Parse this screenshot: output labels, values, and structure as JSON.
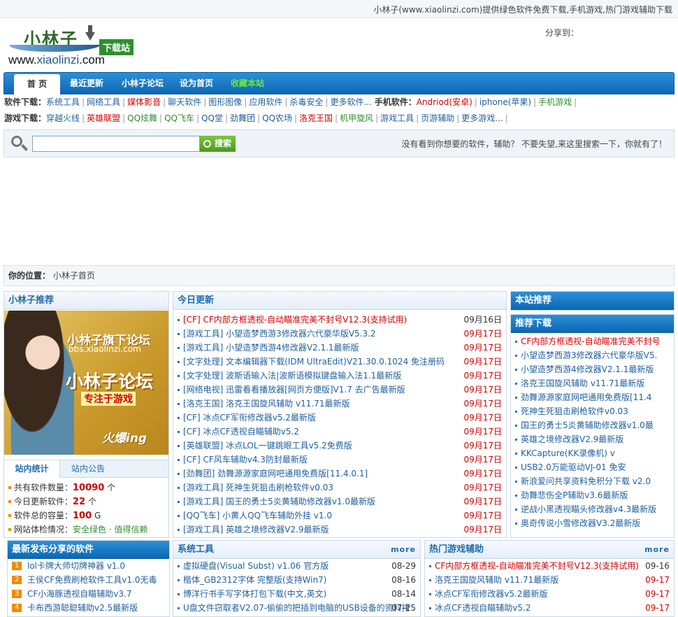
{
  "topbar": {
    "text": "小林子(www.xiaolinzi.com)提供绿色软件免费下载,手机游戏,热门游戏辅助下载"
  },
  "logo": {
    "cn": "小林子",
    "badge": "下载站",
    "url_prefix": "www.",
    "url_main": "xiaolinzi",
    "url_suffix": ".com"
  },
  "share": {
    "label": "分享到："
  },
  "nav": [
    {
      "label": "首 页",
      "active": true
    },
    {
      "label": "最近更新"
    },
    {
      "label": "小林子论坛"
    },
    {
      "label": "设为首页"
    },
    {
      "label": "收藏本站",
      "green": true
    }
  ],
  "software_row": {
    "label": "软件下载：",
    "links": [
      {
        "t": "系统工具"
      },
      {
        "t": "网络工具"
      },
      {
        "t": "媒体影音",
        "c": "red"
      },
      {
        "t": "聊天软件"
      },
      {
        "t": "图形图像"
      },
      {
        "t": "应用软件"
      },
      {
        "t": "杀毒安全"
      },
      {
        "t": "更多软件..."
      }
    ],
    "mobile_label": "手机软件：",
    "mobile_links": [
      {
        "t": "Andriod(安卓)",
        "c": "red"
      },
      {
        "t": "iphone(苹果)"
      },
      {
        "t": "手机游戏",
        "c": "green"
      }
    ]
  },
  "game_row": {
    "label": "游戏下载：",
    "links": [
      {
        "t": "穿越火线"
      },
      {
        "t": "英雄联盟",
        "c": "red"
      },
      {
        "t": "QQ炫舞",
        "c": "green"
      },
      {
        "t": "QQ飞车",
        "c": "green"
      },
      {
        "t": "QQ堂"
      },
      {
        "t": "劲舞团"
      },
      {
        "t": "QQ农场"
      },
      {
        "t": "洛克王国",
        "c": "red"
      },
      {
        "t": "机甲旋风",
        "c": "green"
      },
      {
        "t": "游戏工具"
      },
      {
        "t": "页游辅助"
      },
      {
        "t": "更多游戏..."
      }
    ]
  },
  "search": {
    "placeholder": "",
    "button": "搜索",
    "tip": "没有看到你想要的软件，辅助？ 不要失望,来这里搜索一下，你就有了！"
  },
  "breadcrumb": {
    "label": "你的位置：",
    "path": "小林子首页"
  },
  "left": {
    "title": "小林子推荐",
    "promo": {
      "t1": "小林子旗下论坛",
      "t2": "bbs.xiaolinzi.com",
      "t3": "小林子论坛",
      "t4": "专注于游戏",
      "t5": "火爆ing"
    },
    "tabs": [
      "站内统计",
      "站内公告"
    ],
    "stats": [
      {
        "label": "共有软件数量：",
        "value": "10090",
        "unit": "个"
      },
      {
        "label": "今日更新软件：",
        "value": "22",
        "unit": "个"
      },
      {
        "label": "软件总的容量：",
        "value": "100",
        "unit": "G"
      },
      {
        "label": "网站体检情况：",
        "value": "安全绿色 · 值得信赖",
        "unit": ""
      }
    ]
  },
  "today": {
    "title": "今日更新",
    "items": [
      {
        "t": "[CF] CF内部方框透视-自动瞄准完美不封号V12.3(支持试用)",
        "d": "09月16日",
        "red": true
      },
      {
        "t": "[游戏工具] 小望造梦西游3修改器六代豪华版V5.3.2",
        "d": "09月17日"
      },
      {
        "t": "[游戏工具] 小望造梦西游4修改器V2.1.1最新版",
        "d": "09月17日"
      },
      {
        "t": "[文字处理] 文本编辑器下载(IDM UltraEdit)V21.30.0.1024 免注册码",
        "d": "09月17日"
      },
      {
        "t": "[文字处理] 波斯语输入法|波斯语模拟键盘输入法1.1最新版",
        "d": "09月17日"
      },
      {
        "t": "[网络电视] 迅雷看看播放器[网页方便版]V1.7 去广告最新版",
        "d": "09月17日"
      },
      {
        "t": "[洛克王国] 洛克王国旋风辅助 v11.71最新版",
        "d": "09月17日"
      },
      {
        "t": "[CF] 冰点CF军衔修改器v5.2最新版",
        "d": "09月17日"
      },
      {
        "t": "[CF] 冰点CF透视自瞄辅助v5.2",
        "d": "09月17日"
      },
      {
        "t": "[英雄联盟] 冰点LOL一键跳眼工具v5.2免费版",
        "d": "09月17日"
      },
      {
        "t": "[CF] CF风车辅助v4.3防封最新版",
        "d": "09月17日"
      },
      {
        "t": "[劲舞团] 劲舞源源家庭网吧通用免费版[11.4.0.1]",
        "d": "09月17日"
      },
      {
        "t": "[游戏工具] 死神生死狙击刷枪软件v0.03",
        "d": "09月17日"
      },
      {
        "t": "[游戏工具] 国王的勇士5炎黄辅助修改器v1.0最新版",
        "d": "09月17日"
      },
      {
        "t": "[QQ飞车] 小黄人QQ飞车辅助外挂 v1.0",
        "d": "09月17日"
      },
      {
        "t": "[游戏工具] 英雄之境修改器V2.9最新版",
        "d": "09月17日"
      }
    ]
  },
  "recommend": {
    "title": "本站推荐"
  },
  "downloads": {
    "title": "推荐下载",
    "items": [
      {
        "t": "CF内部方框透视-自动瞄准完美不封号",
        "red": true
      },
      {
        "t": "小望造梦西游3修改器六代豪华版V5."
      },
      {
        "t": "小望造梦西游4修改器V2.1.1最新版"
      },
      {
        "t": "洛克王国旋风辅助 v11.71最新版"
      },
      {
        "t": "劲舞源源家庭网吧通用免费版[11.4"
      },
      {
        "t": "死神生死狙击刷枪软件v0.03"
      },
      {
        "t": "国王的勇士5炎黄辅助修改器v1.0最"
      },
      {
        "t": "英雄之境修改器V2.9最新版"
      },
      {
        "t": "KKCapture(KK录像机) v"
      },
      {
        "t": "USB2.0万能驱动VJ-01 免安"
      },
      {
        "t": "新浪爱问共享资料免积分下载 v2.0"
      },
      {
        "t": "劲舞悲伤全P辅助v3.6最新版"
      },
      {
        "t": "逆战小黑透视瞄头修改器v4.3最新版"
      },
      {
        "t": "奥奇传说小雪修改器V3.2最新版"
      }
    ]
  },
  "newest": {
    "title": "最新发布分享的软件",
    "items": [
      {
        "n": "1",
        "t": "lol卡牌大师切牌神器 v1.0"
      },
      {
        "n": "2",
        "t": "王侯CF免费刷枪软件工具v1.0无毒"
      },
      {
        "n": "3",
        "t": "CF小海豚透视自瞄辅助v3.7"
      },
      {
        "n": "4",
        "t": "卡布西游聪聪辅助v2.5最新版"
      }
    ]
  },
  "system": {
    "title": "系统工具",
    "more": "more",
    "items": [
      {
        "t": "虚拟硬盘(Visual Subst) v1.06 官方版",
        "d": "08-29"
      },
      {
        "t": "楷体_GB2312字体 完整版(支持Win7)",
        "d": "08-16"
      },
      {
        "t": "博洋行书手写字体打包下载(中文,英文)",
        "d": "08-14"
      },
      {
        "t": "U盘文件窃取者V2.07-偷偷的把插到电脑的USB设备的资料拷",
        "d": "07-25"
      }
    ]
  },
  "hot": {
    "title": "热门游戏辅助",
    "more": "more",
    "items": [
      {
        "t": "CF内部方框透视-自动瞄准完美不封号V12.3(支持试用)",
        "d": "09-16",
        "red": true
      },
      {
        "t": "洛克王国旋风辅助 v11.71最新版",
        "d": "09-17"
      },
      {
        "t": "冰点CF军衔修改器v5.2最新版",
        "d": "09-17"
      },
      {
        "t": "冰点CF透视自瞄辅助v5.2",
        "d": "09-17"
      }
    ]
  }
}
